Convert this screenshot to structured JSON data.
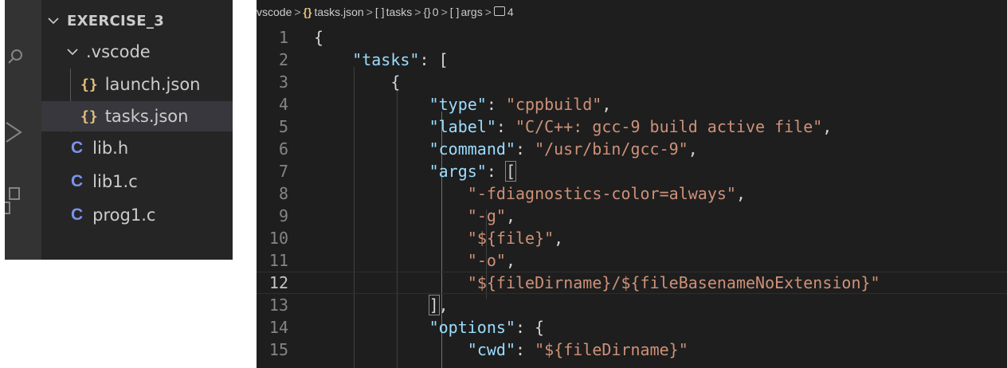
{
  "explorer": {
    "root": "EXERCISE_3",
    "folder": ".vscode",
    "items": [
      {
        "icon": "{}",
        "label": "launch.json"
      },
      {
        "icon": "{}",
        "label": "tasks.json"
      },
      {
        "icon": "C",
        "label": "lib.h"
      },
      {
        "icon": "C",
        "label": "lib1.c"
      },
      {
        "icon": "C",
        "label": "prog1.c"
      }
    ],
    "selected": "tasks.json",
    "activity_icons": [
      "search-icon",
      "run-debug-icon",
      "extensions-icon"
    ]
  },
  "breadcrumb": [
    {
      "icon": "",
      "label": "vscode"
    },
    {
      "icon": "{}",
      "label": "tasks.json"
    },
    {
      "icon": "[ ]",
      "label": "tasks"
    },
    {
      "icon": "{}",
      "label": "0"
    },
    {
      "icon": "[ ]",
      "label": "args"
    },
    {
      "icon": "number-icon",
      "label": "4"
    }
  ],
  "editor": {
    "active_line": 12,
    "lines": [
      {
        "n": "1",
        "tokens": [
          {
            "t": "{",
            "c": "p"
          }
        ]
      },
      {
        "n": "2",
        "tokens": [
          {
            "t": "\"tasks\"",
            "c": "k"
          },
          {
            "t": ": [",
            "c": "p"
          }
        ]
      },
      {
        "n": "3",
        "tokens": [
          {
            "t": "{",
            "c": "p"
          }
        ]
      },
      {
        "n": "4",
        "tokens": [
          {
            "t": "\"type\"",
            "c": "k"
          },
          {
            "t": ": ",
            "c": "p"
          },
          {
            "t": "\"cppbuild\"",
            "c": "s"
          },
          {
            "t": ",",
            "c": "p"
          }
        ]
      },
      {
        "n": "5",
        "tokens": [
          {
            "t": "\"label\"",
            "c": "k"
          },
          {
            "t": ": ",
            "c": "p"
          },
          {
            "t": "\"C/C++: gcc-9 build active file\"",
            "c": "s"
          },
          {
            "t": ",",
            "c": "p"
          }
        ]
      },
      {
        "n": "6",
        "tokens": [
          {
            "t": "\"command\"",
            "c": "k"
          },
          {
            "t": ": ",
            "c": "p"
          },
          {
            "t": "\"/usr/bin/gcc-9\"",
            "c": "s"
          },
          {
            "t": ",",
            "c": "p"
          }
        ]
      },
      {
        "n": "7",
        "tokens": [
          {
            "t": "\"args\"",
            "c": "k"
          },
          {
            "t": ": ",
            "c": "p"
          },
          {
            "t": "[",
            "c": "p bm"
          }
        ]
      },
      {
        "n": "8",
        "tokens": [
          {
            "t": "\"-fdiagnostics-color=always\"",
            "c": "s"
          },
          {
            "t": ",",
            "c": "p"
          }
        ]
      },
      {
        "n": "9",
        "tokens": [
          {
            "t": "\"-g\"",
            "c": "s"
          },
          {
            "t": ",",
            "c": "p"
          }
        ]
      },
      {
        "n": "10",
        "tokens": [
          {
            "t": "\"${file}\"",
            "c": "s"
          },
          {
            "t": ",",
            "c": "p"
          }
        ]
      },
      {
        "n": "11",
        "tokens": [
          {
            "t": "\"-o\"",
            "c": "s"
          },
          {
            "t": ",",
            "c": "p"
          }
        ]
      },
      {
        "n": "12",
        "tokens": [
          {
            "t": "\"${fileDirname}/${fileBasenameNoExtension}\"",
            "c": "s"
          }
        ]
      },
      {
        "n": "13",
        "tokens": [
          {
            "t": "]",
            "c": "p bm"
          },
          {
            "t": ",",
            "c": "p"
          }
        ]
      },
      {
        "n": "14",
        "tokens": [
          {
            "t": "\"options\"",
            "c": "k"
          },
          {
            "t": ": {",
            "c": "p"
          }
        ]
      },
      {
        "n": "15",
        "tokens": [
          {
            "t": "\"cwd\"",
            "c": "k"
          },
          {
            "t": ": ",
            "c": "p"
          },
          {
            "t": "\"${fileDirname}\"",
            "c": "s"
          }
        ]
      }
    ]
  },
  "colors": {
    "key": "#9cdcfe",
    "string": "#ce9178",
    "punctuation": "#d4d4d4",
    "json_icon": "#e5c07b",
    "c_icon": "#7c93ee",
    "editor_bg": "#1e1e1e",
    "sidebar_bg": "#252526"
  }
}
